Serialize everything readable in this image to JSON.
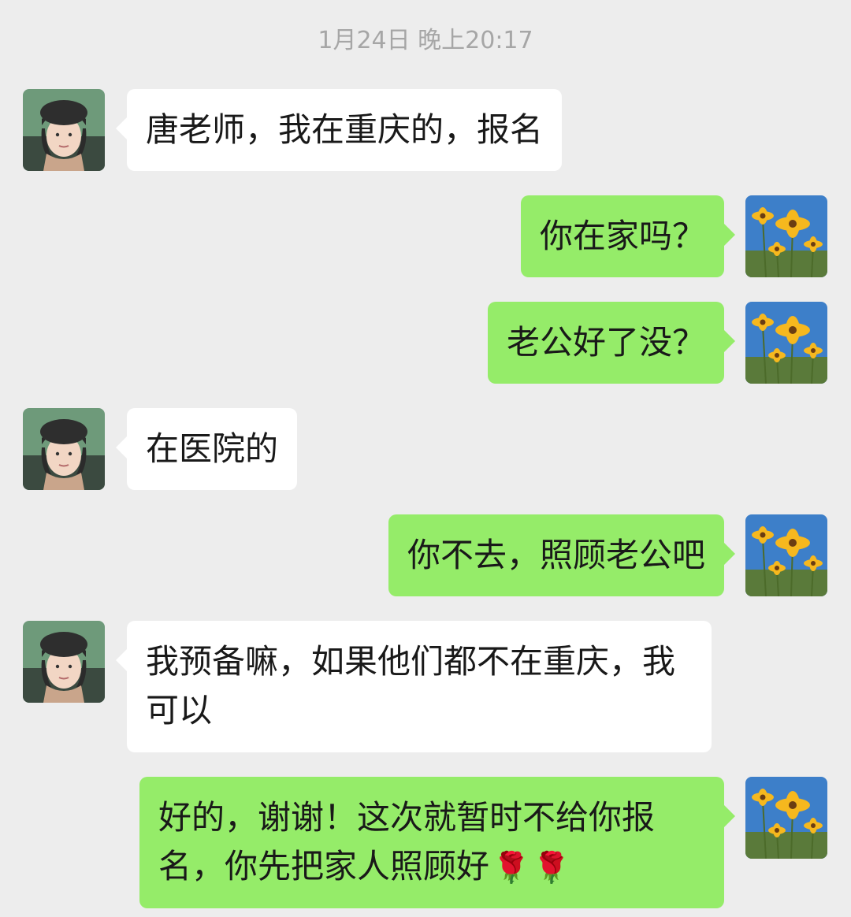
{
  "timestamp": "1月24日 晚上20:17",
  "messages": [
    {
      "side": "left",
      "text": "唐老师，我在重庆的，报名"
    },
    {
      "side": "right",
      "text": "你在家吗？"
    },
    {
      "side": "right",
      "text": "老公好了没？"
    },
    {
      "side": "left",
      "text": "在医院的"
    },
    {
      "side": "right",
      "text": "你不去，照顾老公吧"
    },
    {
      "side": "left",
      "text": "我预备嘛，如果他们都不在重庆，我可以"
    },
    {
      "side": "right",
      "text": "好的，谢谢！这次就暂时不给你报名，你先把家人照顾好",
      "emoji": [
        "🌹",
        "🌹"
      ]
    }
  ],
  "colors": {
    "background": "#ededed",
    "incoming_bubble": "#ffffff",
    "outgoing_bubble": "#95ec69",
    "timestamp_text": "#a6a6a6"
  },
  "icons": {
    "contact_avatar": "woman-portrait-avatar",
    "self_avatar": "yellow-flowers-avatar",
    "emoji": "rose-emoji"
  }
}
